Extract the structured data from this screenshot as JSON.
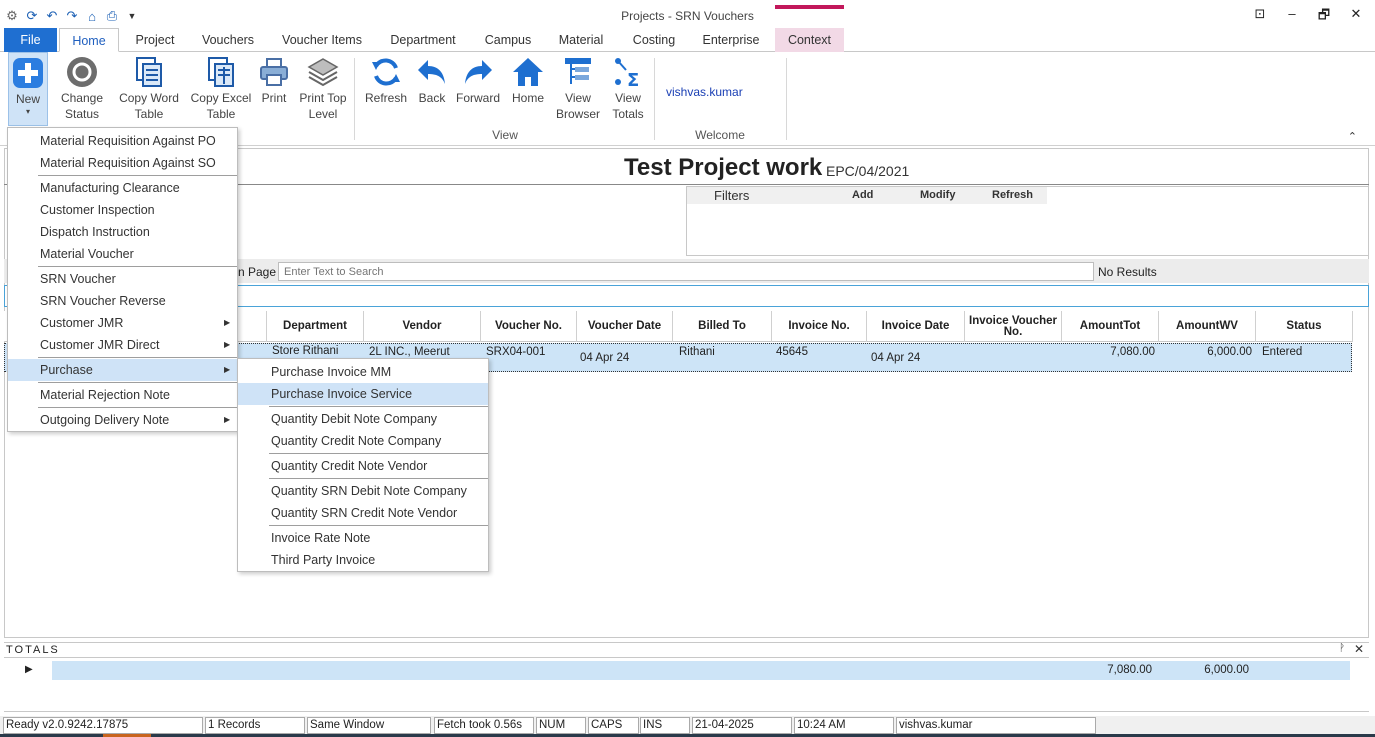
{
  "window": {
    "title": "Projects - SRN Vouchers",
    "controls": [
      "⊡",
      "–",
      "🗗",
      "✕"
    ]
  },
  "qat_icons": [
    "app-icon",
    "refresh-icon",
    "undo-icon",
    "redo-icon",
    "home-icon",
    "print-icon",
    "dropdown-icon"
  ],
  "tabs": [
    "File",
    "Home",
    "Project",
    "Vouchers",
    "Voucher Items",
    "Department",
    "Campus",
    "Material",
    "Costing",
    "Enterprise",
    "Context"
  ],
  "ribbon": {
    "new": "New",
    "change_status": [
      "Change",
      "Status"
    ],
    "copy_word": [
      "Copy Word",
      "Table"
    ],
    "copy_excel": [
      "Copy Excel",
      "Table"
    ],
    "print": "Print",
    "print_top": [
      "Print Top",
      "Level"
    ],
    "refresh": "Refresh",
    "back": "Back",
    "forward": "Forward",
    "home": "Home",
    "view_browser": [
      "View",
      "Browser"
    ],
    "view_totals": [
      "View",
      "Totals"
    ],
    "group_view": "View",
    "group_welcome": "Welcome",
    "user": "vishvas.kumar",
    "collapse": "⌃"
  },
  "project": {
    "title": "Test Project work",
    "code": "EPC/04/2021"
  },
  "filters": {
    "label": "Filters",
    "add": "Add",
    "modify": "Modify",
    "refresh": "Refresh"
  },
  "search": {
    "label": "n Page",
    "placeholder": "Enter Text to Search",
    "result": "No Results"
  },
  "grid": {
    "columns": [
      "Department",
      "Vendor",
      "Voucher No.",
      "Voucher Date",
      "Billed To",
      "Invoice No.",
      "Invoice Date",
      "Invoice Voucher No.",
      "AmountTot",
      "AmountWV",
      "Status"
    ],
    "rows": [
      [
        "Store Rithani",
        "2L INC., Meerut",
        "SRX04-001",
        "04 Apr 24",
        "Rithani",
        "45645",
        "04 Apr 24",
        "",
        "7,080.00",
        "6,000.00",
        "Entered"
      ]
    ]
  },
  "totals": {
    "label": "TOTALS",
    "pin": "ᚹ",
    "close": "✕",
    "amount_tot": "7,080.00",
    "amount_wv": "6,000.00"
  },
  "status_bar": [
    "Ready v2.0.9242.17875",
    "1 Records",
    "Same Window",
    "Fetch took 0.56s",
    "NUM",
    "CAPS",
    "INS",
    "21-04-2025",
    "10:24 AM",
    "vishvas.kumar"
  ],
  "new_menu": [
    "Material Requisition Against PO",
    "Material Requisition Against SO",
    "Manufacturing Clearance",
    "Customer Inspection",
    "Dispatch Instruction",
    "Material Voucher",
    "SRN Voucher",
    "SRN Voucher Reverse",
    "Customer JMR",
    "Customer JMR Direct",
    "Purchase",
    "Material Rejection Note",
    "Outgoing Delivery Note"
  ],
  "purchase_menu": [
    "Purchase Invoice MM",
    "Purchase Invoice Service",
    "Quantity Debit Note Company",
    "Quantity Credit Note Company",
    "Quantity Credit Note Vendor",
    "Quantity SRN Debit Note Company",
    "Quantity SRN Credit Note Vendor",
    "Invoice Rate Note",
    "Third Party Invoice"
  ],
  "colors": {
    "accent": "#1f6fd1",
    "highlight": "#cfe3f7",
    "context": "#c2185b"
  }
}
